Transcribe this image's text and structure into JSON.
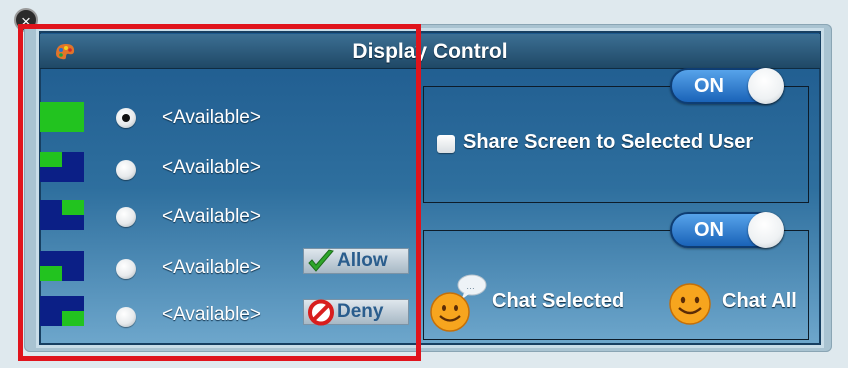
{
  "window": {
    "title": "Display Control"
  },
  "icons": {
    "app_close": "close-circle-icon",
    "title": "palette-icon",
    "allow": "check-icon",
    "deny": "no-entry-icon",
    "chat_selected": "smiley-speech-icon",
    "chat_all": "smiley-icon"
  },
  "slots": [
    {
      "label": "<Available>",
      "selected": true,
      "layout": "full"
    },
    {
      "label": "<Available>",
      "selected": false,
      "layout": "top-left-quarter"
    },
    {
      "label": "<Available>",
      "selected": false,
      "layout": "top-right-quarter"
    },
    {
      "label": "<Available>",
      "selected": false,
      "layout": "bottom-left-quarter"
    },
    {
      "label": "<Available>",
      "selected": false,
      "layout": "bottom-right-quarter"
    }
  ],
  "actions": {
    "allow_label": "Allow",
    "deny_label": "Deny"
  },
  "share": {
    "toggle_label": "ON",
    "checkbox_label": "Share Screen to Selected User",
    "checked": false
  },
  "chat": {
    "toggle_label": "ON",
    "selected_label": "Chat Selected",
    "all_label": "Chat All"
  },
  "colors": {
    "layout_green": "#22c31f",
    "layout_navy": "#0b1f86",
    "highlight": "#e0141c"
  }
}
